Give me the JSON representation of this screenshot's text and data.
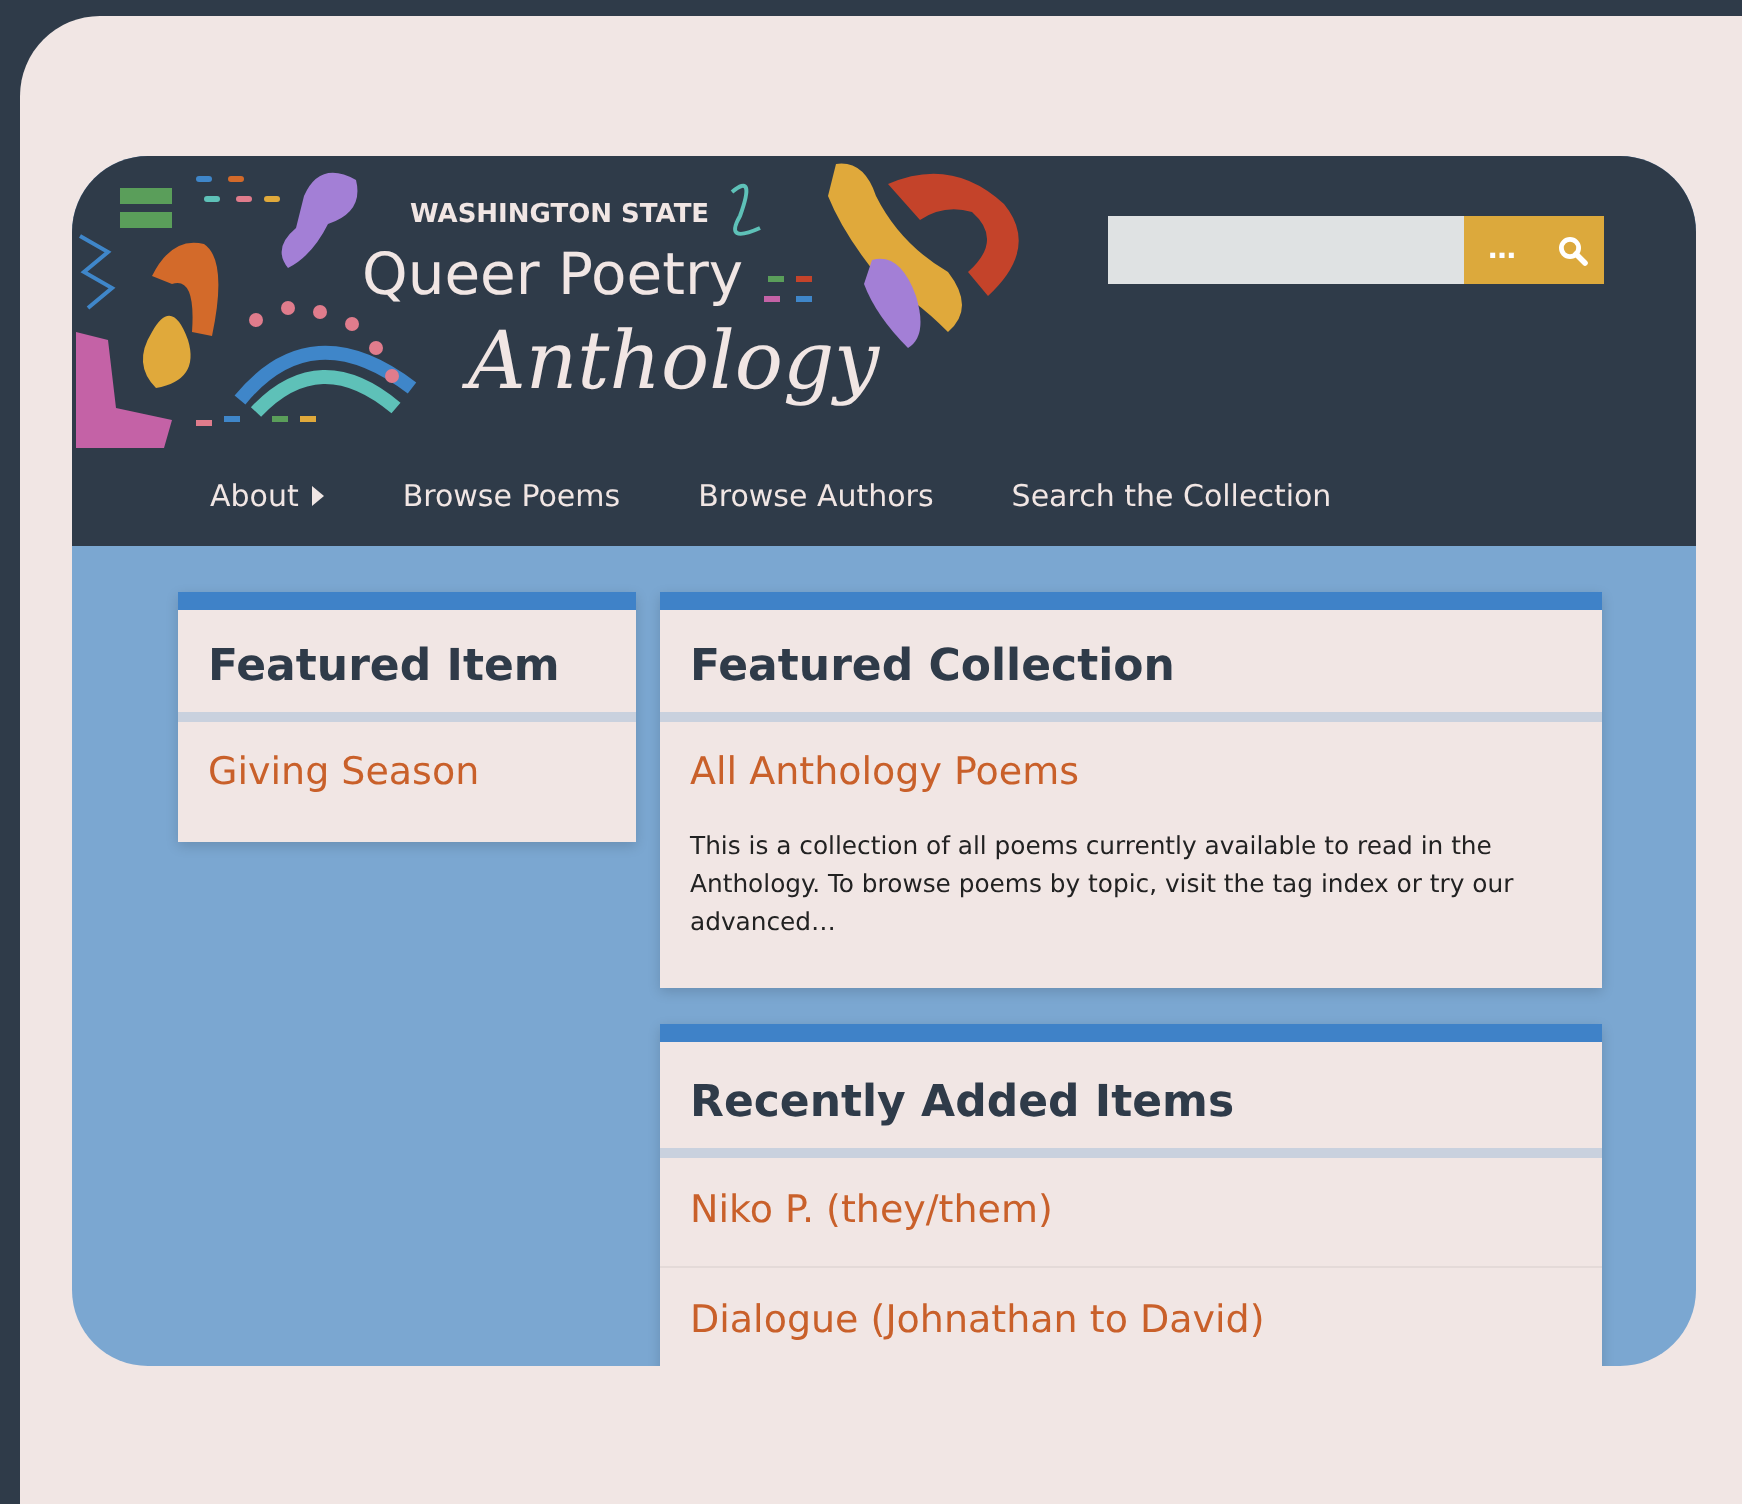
{
  "logo": {
    "state": "WASHINGTON STATE",
    "line_1": "Queer Poetry",
    "line_2": "Anthology"
  },
  "search": {
    "button_label": "…"
  },
  "nav": [
    {
      "label": "About",
      "has_submenu": true
    },
    {
      "label": "Browse Poems",
      "has_submenu": false
    },
    {
      "label": "Browse Authors",
      "has_submenu": false
    },
    {
      "label": "Search the Collection",
      "has_submenu": false
    }
  ],
  "featured_item": {
    "title": "Featured Item",
    "link": "Giving Season"
  },
  "featured_collection": {
    "title": "Featured Collection",
    "link": "All Anthology Poems",
    "description": "This is a collection of all poems currently available to read in the Anthology. To browse poems by topic, visit the tag index or try our advanced…"
  },
  "recently_added": {
    "title": "Recently Added Items",
    "items": [
      "Niko P. (they/them)",
      "Dialogue (Johnathan to David)"
    ]
  }
}
